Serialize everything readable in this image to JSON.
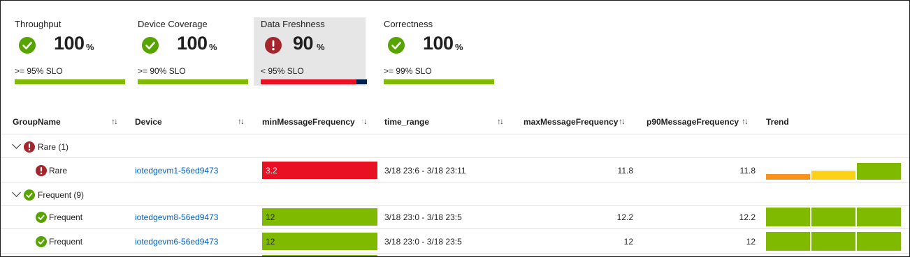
{
  "tiles": [
    {
      "title": "Throughput",
      "status": "ok",
      "value": "100",
      "unit": "%",
      "slo": ">= 95% SLO",
      "bar_fraction": 1.0
    },
    {
      "title": "Device Coverage",
      "status": "ok",
      "value": "100",
      "unit": "%",
      "slo": ">= 90% SLO",
      "bar_fraction": 1.0
    },
    {
      "title": "Data Freshness",
      "status": "error",
      "value": "90",
      "unit": "%",
      "slo": "< 95% SLO",
      "bar_fraction": 0.9
    },
    {
      "title": "Correctness",
      "status": "ok",
      "value": "100",
      "unit": "%",
      "slo": ">= 99% SLO",
      "bar_fraction": 1.0
    }
  ],
  "columns": {
    "group": "GroupName",
    "device": "Device",
    "min": "minMessageFrequency",
    "time": "time_range",
    "max": "maxMessageFrequency",
    "p90": "p90MessageFrequency",
    "trend": "Trend"
  },
  "sort_glyph": "↑↓",
  "groups": [
    {
      "label": "Rare (1)",
      "status": "error",
      "rows": [
        {
          "group": "Rare",
          "status": "error",
          "device": "iotedgevm1-56ed9473",
          "min": "3.2",
          "min_color": "#e81123",
          "min_text_color": "#ffffff",
          "time": "3/18 23:6 - 3/18 23:11",
          "max": "11.8",
          "p90": "11.8",
          "trend": [
            {
              "level": 0.3,
              "color": "#f7921e"
            },
            {
              "level": 0.5,
              "color": "#fcd116"
            },
            {
              "level": 0.88,
              "color": "#7fba00"
            }
          ]
        }
      ]
    },
    {
      "label": "Frequent (9)",
      "status": "ok",
      "rows": [
        {
          "group": "Frequent",
          "status": "ok",
          "device": "iotedgevm8-56ed9473",
          "min": "12",
          "min_color": "#7fba00",
          "min_text_color": "#1f1f1f",
          "time": "3/18 23:0 - 3/18 23:5",
          "max": "12.2",
          "p90": "12.2",
          "trend": [
            {
              "level": 1.0,
              "color": "#7fba00"
            },
            {
              "level": 1.0,
              "color": "#7fba00"
            },
            {
              "level": 1.0,
              "color": "#7fba00"
            }
          ]
        },
        {
          "group": "Frequent",
          "status": "ok",
          "device": "iotedgevm6-56ed9473",
          "min": "12",
          "min_color": "#7fba00",
          "min_text_color": "#1f1f1f",
          "time": "3/18 23:0 - 3/18 23:5",
          "max": "12",
          "p90": "12",
          "trend": [
            {
              "level": 1.0,
              "color": "#7fba00"
            },
            {
              "level": 1.0,
              "color": "#7fba00"
            },
            {
              "level": 1.0,
              "color": "#7fba00"
            }
          ]
        }
      ]
    }
  ],
  "colors": {
    "ok": "#57a300",
    "error": "#a4262c",
    "good_bar": "#7fba00",
    "bad_bar": "#e81123",
    "link": "#0060c0"
  }
}
